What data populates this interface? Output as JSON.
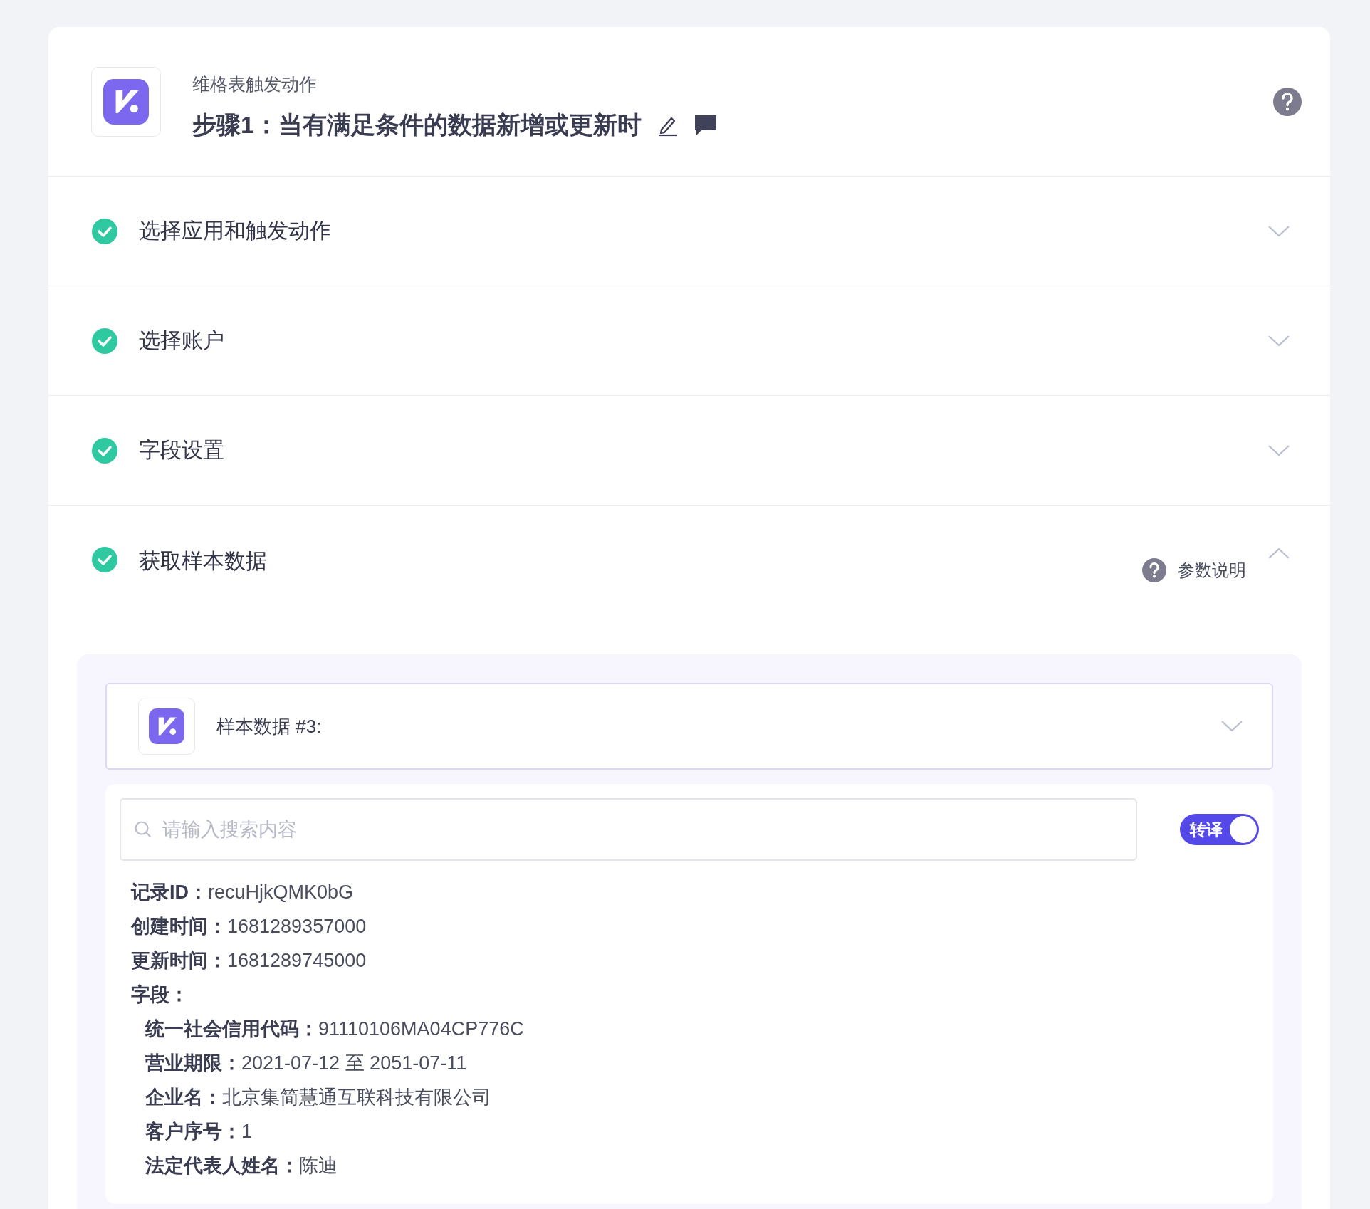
{
  "header": {
    "app_name": "维格表触发动作",
    "step_title": "步骤1：当有满足条件的数据新增或更新时"
  },
  "sections": [
    {
      "title": "选择应用和触发动作",
      "done": true,
      "expanded": false
    },
    {
      "title": "选择账户",
      "done": true,
      "expanded": false
    },
    {
      "title": "字段设置",
      "done": true,
      "expanded": false
    },
    {
      "title": "获取样本数据",
      "done": true,
      "expanded": true,
      "help_link": "参数说明"
    }
  ],
  "sample": {
    "title": "样本数据 #3:",
    "expanded": false
  },
  "search": {
    "placeholder": "请输入搜索内容"
  },
  "toggle": {
    "label": "转译",
    "on": true
  },
  "record": [
    {
      "label": "记录ID：",
      "value": "recuHjkQMK0bG"
    },
    {
      "label": "创建时间：",
      "value": "1681289357000"
    },
    {
      "label": "更新时间：",
      "value": "1681289745000"
    },
    {
      "label": "字段：",
      "children": [
        {
          "label": "统一社会信用代码：",
          "value": "91110106MA04CP776C"
        },
        {
          "label": "营业期限：",
          "value": "2021-07-12 至 2051-07-11"
        },
        {
          "label": "企业名：",
          "value": "北京集简慧通互联科技有限公司"
        },
        {
          "label": "客户序号：",
          "value": "1"
        },
        {
          "label": "法定代表人姓名：",
          "value": "陈迪"
        }
      ]
    }
  ]
}
